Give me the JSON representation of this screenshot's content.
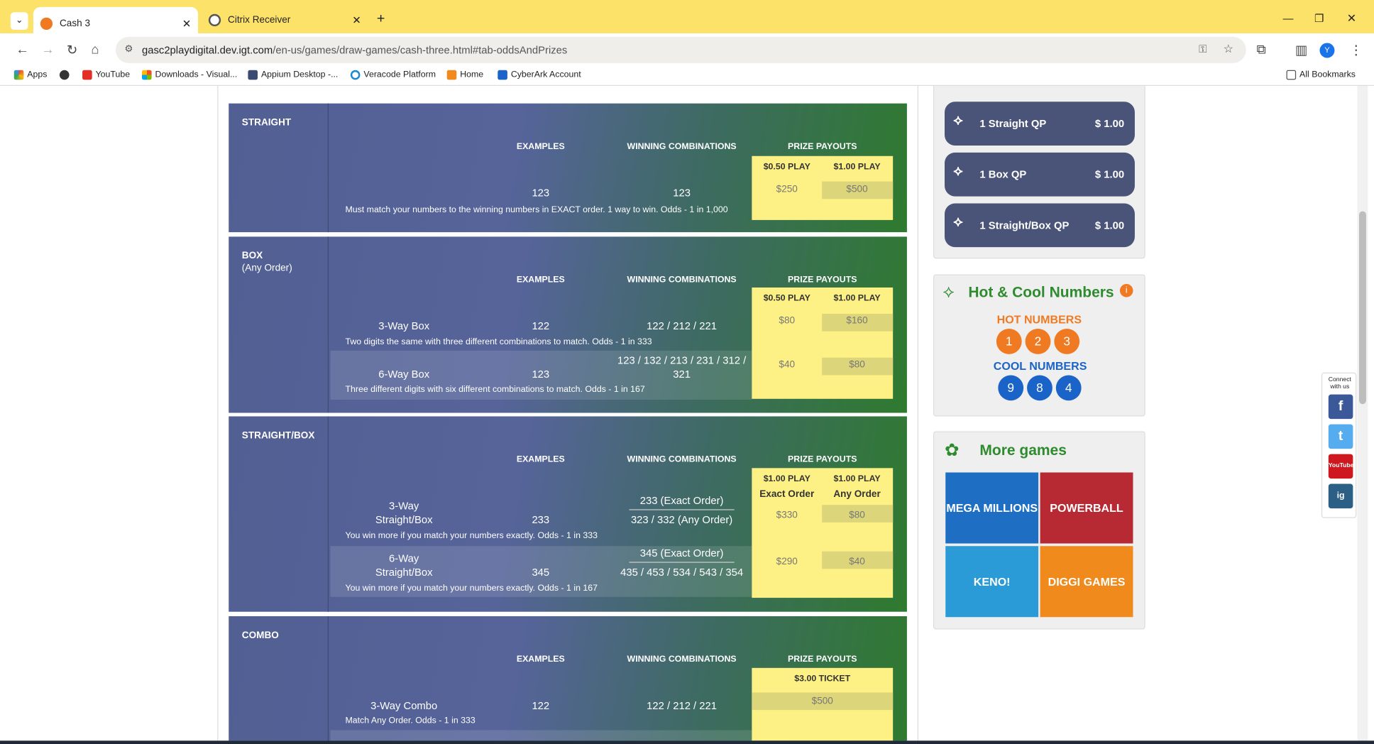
{
  "browser": {
    "tabs": [
      {
        "label": "Cash 3"
      },
      {
        "label": "Citrix Receiver"
      }
    ],
    "url_host": "gasc2playdigital.dev.igt.com",
    "url_path": "/en-us/games/draw-games/cash-three.html#tab-oddsAndPrizes",
    "profile_initial": "Y",
    "bookmarks": [
      {
        "label": "Apps",
        "icon": "apps-grid-icon"
      },
      {
        "label": "",
        "icon": "globe-icon"
      },
      {
        "label": "YouTube",
        "icon": "youtube-icon"
      },
      {
        "label": "Downloads - Visual...",
        "icon": "microsoft-icon"
      },
      {
        "label": "Appium Desktop -...",
        "icon": "appium-icon"
      },
      {
        "label": "Veracode Platform",
        "icon": "veracode-icon"
      },
      {
        "label": "Home",
        "icon": "home-icon"
      },
      {
        "label": "CyberArk Account",
        "icon": "cyberark-icon"
      }
    ],
    "all_bookmarks": "All Bookmarks"
  },
  "colors": {
    "chrome": "#fde26a",
    "prize": "#fdf185",
    "pill": "#4a5478",
    "hot": "#f07a22",
    "cool": "#1a63c9",
    "green": "#2e8b2e"
  },
  "odds": {
    "headers": {
      "examples": "EXAMPLES",
      "winning": "WINNING COMBINATIONS",
      "payouts": "PRIZE PAYOUTS"
    },
    "straight": {
      "title": "STRAIGHT",
      "play1": "$0.50 PLAY",
      "play2": "$1.00 PLAY",
      "example": "123",
      "winning": "123",
      "p1": "$250",
      "p2": "$500",
      "odds": "Must match your numbers to the winning numbers in EXACT order. 1 way to win. Odds - 1 in 1,000"
    },
    "box": {
      "title": "BOX",
      "subtitle": "(Any Order)",
      "play1": "$0.50 PLAY",
      "play2": "$1.00 PLAY",
      "rows": [
        {
          "name": "3-Way Box",
          "example": "122",
          "winning": "122 / 212 / 221",
          "p1": "$80",
          "p2": "$160",
          "odds": "Two digits the same with three different combinations to match. Odds - 1 in 333"
        },
        {
          "name": "6-Way Box",
          "example": "123",
          "winning": "123 / 132 / 213 / 231 / 312 / 321",
          "p1": "$40",
          "p2": "$80",
          "odds": "Three different digits with six different combinations to match. Odds - 1 in 167"
        }
      ]
    },
    "straightbox": {
      "title": "STRAIGHT/BOX",
      "play1": "$1.00 PLAY",
      "play2": "$1.00 PLAY",
      "sub1": "Exact Order",
      "sub2": "Any Order",
      "rows": [
        {
          "name1": "3-Way",
          "name2": "Straight/Box",
          "example": "233",
          "win1": "233 (Exact Order)",
          "win2": "323 / 332 (Any Order)",
          "p1": "$330",
          "p2": "$80",
          "odds": "You win more if you match your numbers exactly. Odds - 1 in 333"
        },
        {
          "name1": "6-Way",
          "name2": "Straight/Box",
          "example": "345",
          "win1": "345 (Exact Order)",
          "win2": "435 / 453 / 534 / 543 / 354",
          "p1": "$290",
          "p2": "$40",
          "odds": "You win more if you match your numbers exactly. Odds - 1 in 167"
        }
      ]
    },
    "combo": {
      "title": "COMBO",
      "ticket": "$3.00 TICKET",
      "name": "3-Way Combo",
      "example": "122",
      "winning": "122 / 212 / 221",
      "p1": "$500",
      "odds": "Match Any Order. Odds - 1 in 333"
    }
  },
  "sidebar": {
    "quickpicks": [
      {
        "label": "1 Straight QP",
        "price": "$ 1.00"
      },
      {
        "label": "1 Box QP",
        "price": "$ 1.00"
      },
      {
        "label": "1 Straight/Box QP",
        "price": "$ 1.00"
      }
    ],
    "hotcool": {
      "title": "Hot & Cool Numbers",
      "hot_label": "HOT NUMBERS",
      "hot": [
        "1",
        "2",
        "3"
      ],
      "cool_label": "COOL NUMBERS",
      "cool": [
        "9",
        "8",
        "4"
      ]
    },
    "more_games": {
      "title": "More games",
      "games": [
        {
          "name": "MEGA MILLIONS",
          "color": "#1e6fc4"
        },
        {
          "name": "POWERBALL",
          "color": "#b82a33"
        },
        {
          "name": "KENO!",
          "color": "#2b9bd8"
        },
        {
          "name": "DIGGI GAMES",
          "color": "#f08a1c"
        }
      ]
    },
    "social": {
      "label": "Connect with us",
      "items": [
        "f",
        "t",
        "YouTube",
        "ig"
      ]
    }
  }
}
